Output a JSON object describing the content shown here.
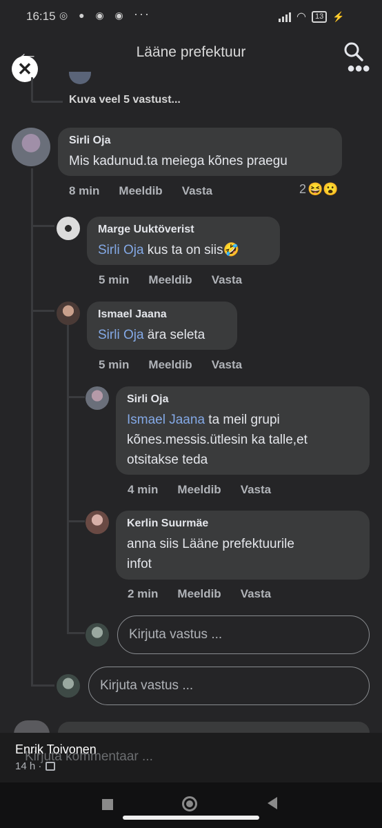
{
  "status_bar": {
    "time": "16:15",
    "battery": "13"
  },
  "header": {
    "title": "Lääne prefektuur"
  },
  "thread": {
    "show_more": "Kuva veel 5 vastust..."
  },
  "actions": {
    "like": "Meeldib",
    "reply": "Vasta"
  },
  "comments": [
    {
      "author": "Sirli Oja",
      "text": "Mis kadunud.ta meiega kõnes praegu",
      "time": "8 min",
      "reaction_count": "2",
      "reactions": "😆😮"
    },
    {
      "author": "Marge Uuktöverist",
      "mention": "Sirli Oja",
      "text": " kus ta on siis🤣",
      "time": "5 min"
    },
    {
      "author": "Ismael Jaana",
      "mention": "Sirli Oja",
      "text": " ära seleta",
      "time": "5 min"
    },
    {
      "author": "Sirli Oja",
      "mention": "Ismael Jaana",
      "text_line1": " ta meil grupi",
      "text_line2": "kõnes.messis.ütlesin ka talle,et",
      "text_line3": "otsitakse teda",
      "time": "4 min"
    },
    {
      "author": "Kerlin Suurmäe",
      "text_line1": "anna siis Lääne prefektuurile",
      "text_line2": "infot",
      "time": "2 min"
    }
  ],
  "reply_inputs": {
    "placeholder": "Kirjuta vastus ..."
  },
  "bottom": {
    "name": "Enrik Toivonen",
    "time": "14 h ·",
    "ghost": "Kirjuta kommentaar ..."
  },
  "colors": {
    "background": "#252527",
    "bubble": "#3a3b3c",
    "mention": "#84a9e6"
  }
}
